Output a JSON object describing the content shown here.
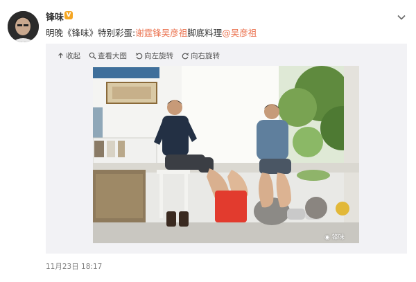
{
  "user": {
    "name": "锋味",
    "verified_badge": "V"
  },
  "post": {
    "text_prefix": "明晚《锋味》特别彩蛋:",
    "link_1": "谢霆锋吴彦祖",
    "text_middle": "脚底料理",
    "link_2": "@吴彦祖"
  },
  "toolbar": {
    "collapse_label": "收起",
    "view_large_label": "查看大图",
    "rotate_left_label": "向左旋转",
    "rotate_right_label": "向右旋转"
  },
  "photo": {
    "watermark": "锋味"
  },
  "meta": {
    "timestamp": "11月23日 18:17"
  },
  "colors": {
    "link": "#eb7350",
    "badge": "#f5a623",
    "media_background": "#f2f2f5",
    "timestamp": "#808080"
  },
  "icons": [
    "chevron-down-icon",
    "collapse-icon",
    "search-icon",
    "rotate-left-icon",
    "rotate-right-icon",
    "weibo-icon"
  ]
}
